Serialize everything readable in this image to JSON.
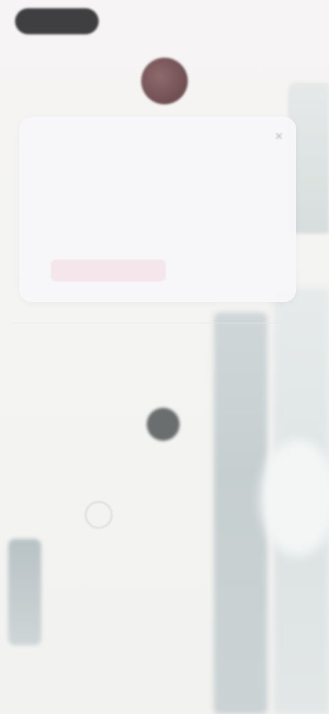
{
  "status_bar": {
    "left_pill": "",
    "right": ""
  },
  "top_row": {
    "left": "",
    "right": ""
  },
  "card": {
    "lines": [
      "",
      "",
      "",
      ""
    ],
    "button": ""
  },
  "labels": [
    "",
    "",
    "",
    "",
    ""
  ]
}
